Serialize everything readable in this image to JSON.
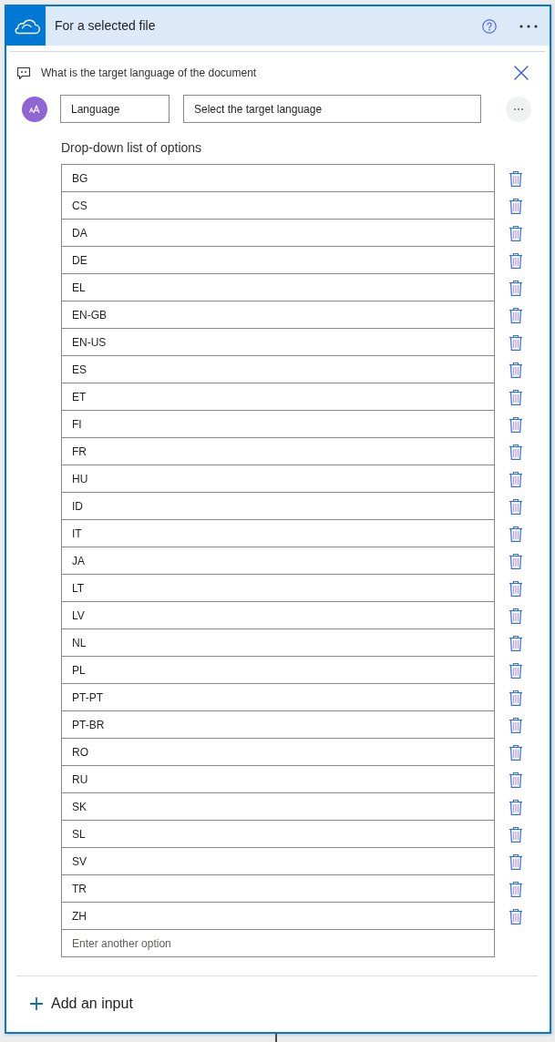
{
  "header": {
    "title": "For a selected file"
  },
  "question": {
    "text": "What is the target language of the document"
  },
  "input": {
    "name": "Language",
    "description": "Select the target language"
  },
  "options_label": "Drop-down list of options",
  "options": [
    "BG",
    "CS",
    "DA",
    "DE",
    "EL",
    "EN-GB",
    "EN-US",
    "ES",
    "ET",
    "FI",
    "FR",
    "HU",
    "ID",
    "IT",
    "JA",
    "LT",
    "LV",
    "NL",
    "PL",
    "PT-PT",
    "PT-BR",
    "RO",
    "RU",
    "SK",
    "SL",
    "SV",
    "TR",
    "ZH"
  ],
  "new_option": {
    "placeholder": "Enter another option"
  },
  "add_button": {
    "label": "Add an input"
  }
}
